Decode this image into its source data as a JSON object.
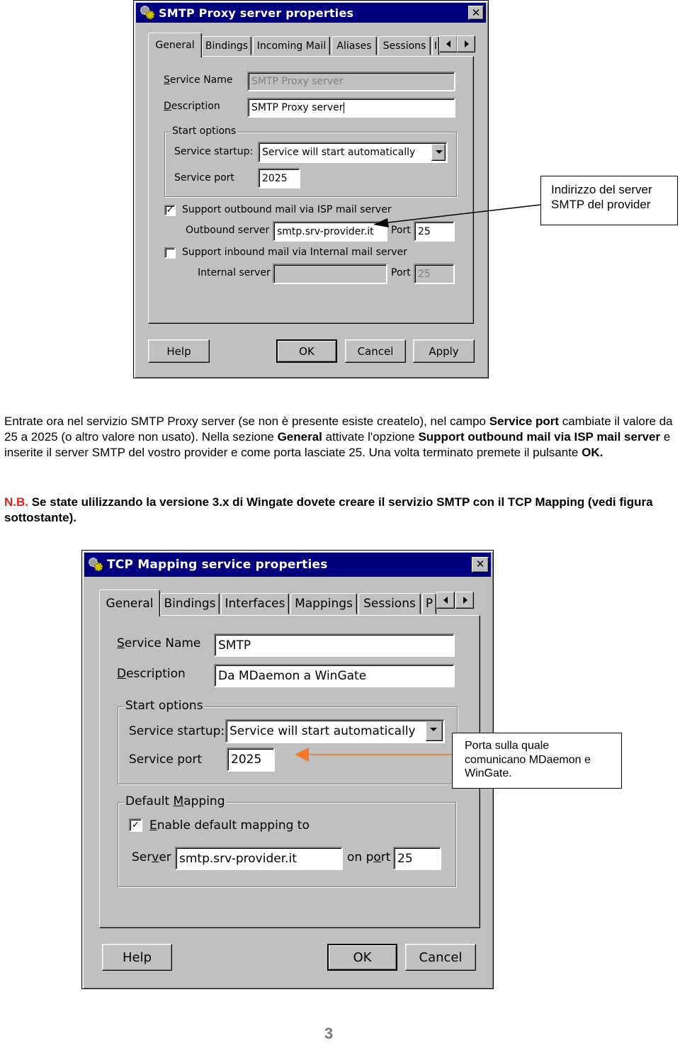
{
  "dialog1": {
    "title": "SMTP Proxy server properties",
    "icon": "gears-icon",
    "close_label": "✕",
    "tabs": [
      {
        "label": "General",
        "active": true
      },
      {
        "label": "Bindings",
        "active": false
      },
      {
        "label": "Incoming Mail",
        "active": false
      },
      {
        "label": "Aliases",
        "active": false
      },
      {
        "label": "Sessions",
        "active": false
      },
      {
        "label": "I",
        "active": false
      }
    ],
    "service_name_label": "Service Name",
    "service_name_value": "SMTP Proxy server",
    "description_label": "Description",
    "description_value": "SMTP Proxy server",
    "start_options_label": "Start options",
    "service_startup_label": "Service startup:",
    "service_startup_value": "Service will start automatically",
    "service_port_label": "Service port",
    "service_port_value": "2025",
    "outbound_checkbox_label": "Support outbound mail via ISP mail server",
    "outbound_checked": true,
    "outbound_server_label": "Outbound server",
    "outbound_server_value": "smtp.srv-provider.it",
    "outbound_port_label": "Port",
    "outbound_port_value": "25",
    "inbound_checkbox_label": "Support inbound mail via Internal mail server",
    "inbound_checked": false,
    "internal_server_label": "Internal server",
    "internal_server_value": "",
    "internal_port_label": "Port",
    "internal_port_value": "25",
    "buttons": {
      "help": "Help",
      "ok": "OK",
      "cancel": "Cancel",
      "apply": "Apply"
    }
  },
  "callout1": {
    "line1": "Indirizzo del server",
    "line2": "SMTP del provider"
  },
  "paragraph": {
    "p1_a": "Entrate ora nel servizio SMTP Proxy server (se non è presente esiste createlo), nel campo ",
    "p1_b": "Service port",
    "p1_c": " cambiate il valore da 25 a 2025 (o altro valore non usato). Nella sezione ",
    "p1_d": "General",
    "p1_e": "  attivate l'opzione ",
    "p1_f": "Support outbound mail via ISP mail server",
    "p1_g": " e inserite il server SMTP del vostro provider e come porta lasciate 25. Una volta terminato premete il pulsante ",
    "p1_h": "OK.",
    "nb_label": "N.B.",
    "nb_text": " Se state ulilizzando la versione 3.x di Wingate dovete creare il servizio SMTP con il TCP Mapping (vedi figura sottostante)."
  },
  "dialog2": {
    "title": "TCP Mapping service properties",
    "icon": "gears-icon",
    "close_label": "✕",
    "tabs": [
      {
        "label": "General",
        "active": true
      },
      {
        "label": "Bindings",
        "active": false
      },
      {
        "label": "Interfaces",
        "active": false
      },
      {
        "label": "Mappings",
        "active": false
      },
      {
        "label": "Sessions",
        "active": false
      },
      {
        "label": "P",
        "active": false
      }
    ],
    "service_name_label": "Service Name",
    "service_name_value": "SMTP",
    "description_label": "Description",
    "description_value": "Da MDaemon a WinGate",
    "start_options_label": "Start options",
    "service_startup_label": "Service startup:",
    "service_startup_value": "Service will start automatically",
    "service_port_label": "Service port",
    "service_port_value": "2025",
    "default_mapping_label": "Default Mapping",
    "enable_mapping_label": "Enable default mapping to",
    "enable_mapping_checked": true,
    "server_label": "Server",
    "server_value": "smtp.srv-provider.it",
    "on_port_label": "on port",
    "on_port_value": "25",
    "buttons": {
      "help": "Help",
      "ok": "OK",
      "cancel": "Cancel"
    }
  },
  "callout2": {
    "line1": "Porta sulla quale",
    "line2": "comunicano MDaemon e",
    "line3": "WinGate.",
    "arrow_color": "#f07a2a"
  },
  "page_number": "3"
}
